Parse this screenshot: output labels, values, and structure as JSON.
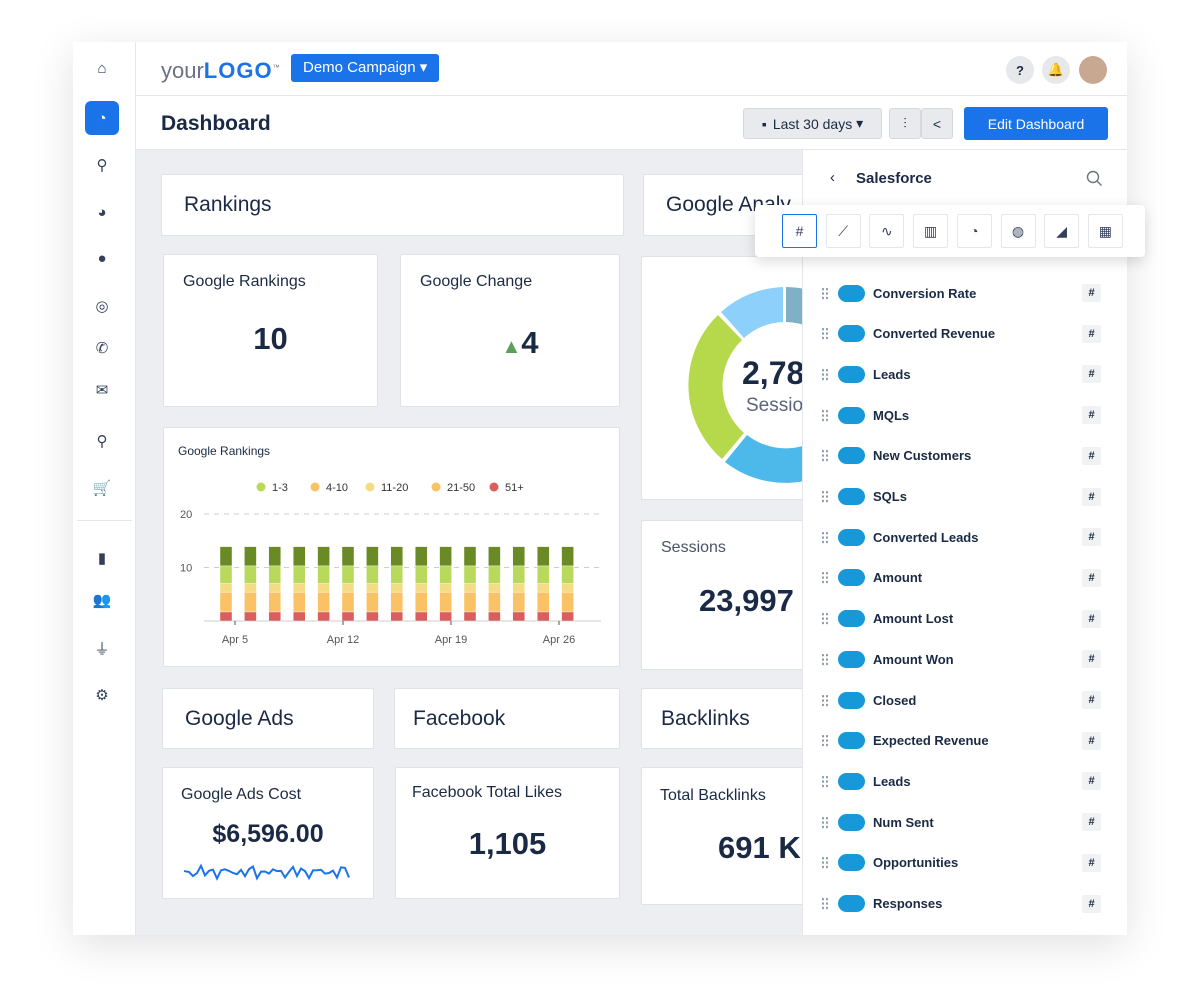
{
  "header": {
    "logo": "yourLOGO",
    "campaign": "Demo Campaign",
    "help": "?"
  },
  "toolbar": {
    "title": "Dashboard",
    "date_range": "Last 30 days",
    "edit": "Edit Dashboard"
  },
  "sidebar": {
    "icons": [
      "home-icon",
      "dashboard-icon",
      "search-icon",
      "pie-chart-icon",
      "chat-icon",
      "target-icon",
      "phone-icon",
      "mail-icon",
      "location-icon",
      "cart-icon",
      "document-icon",
      "users-icon",
      "plug-icon",
      "gear-icon"
    ]
  },
  "widgets": {
    "rankings_header": "Rankings",
    "google_rankings": {
      "label": "Google Rankings",
      "value": "10"
    },
    "google_change": {
      "label": "Google Change",
      "value": "4",
      "direction": "up"
    },
    "analytics_header": "Google Analy",
    "donut": {
      "value": "2,78",
      "label": "Sessio"
    },
    "sessions": {
      "label": "Sessions",
      "value": "23,997"
    },
    "ads_header": "Google Ads",
    "facebook_header": "Facebook",
    "backlinks_header": "Backlinks",
    "ads_cost": {
      "label": "Google Ads Cost",
      "value": "$6,596.00"
    },
    "fb_likes": {
      "label": "Facebook Total Likes",
      "value": "1,105"
    },
    "backlinks": {
      "label": "Total Backlinks",
      "value": "691 K"
    }
  },
  "chart_data": {
    "type": "bar",
    "stacked": true,
    "title": "Google Rankings",
    "ylim": [
      0,
      20
    ],
    "yticks": [
      "10",
      "20"
    ],
    "xticks": [
      "Apr 5",
      "Apr 12",
      "Apr 19",
      "Apr 26"
    ],
    "bars": 15,
    "grid": "dashed",
    "legend_position": "top",
    "series": [
      {
        "name": "51+",
        "color": "#d95f5f",
        "values": [
          1.7,
          1.7,
          1.7,
          1.7,
          1.7,
          1.7,
          1.7,
          1.7,
          1.7,
          1.7,
          1.7,
          1.7,
          1.7,
          1.7,
          1.7
        ]
      },
      {
        "name": "21-50",
        "color": "#f9c265",
        "values": [
          3.7,
          3.7,
          3.7,
          3.7,
          3.7,
          3.7,
          3.7,
          3.7,
          3.7,
          3.7,
          3.7,
          3.7,
          3.7,
          3.7,
          3.7
        ]
      },
      {
        "name": "11-20",
        "color": "#f3dc85",
        "values": [
          1.6,
          1.6,
          1.6,
          1.6,
          1.6,
          1.6,
          1.6,
          1.6,
          1.6,
          1.6,
          1.6,
          1.6,
          1.6,
          1.6,
          1.6
        ]
      },
      {
        "name": "1-3",
        "color": "#b8d95c",
        "values": [
          3.3,
          3.3,
          3.3,
          3.3,
          3.3,
          3.3,
          3.3,
          3.3,
          3.3,
          3.3,
          3.3,
          3.3,
          3.3,
          3.3,
          3.3
        ]
      },
      {
        "color": "#6a8a25",
        "values": [
          3.6,
          3.6,
          3.6,
          3.6,
          3.6,
          3.6,
          3.6,
          3.6,
          3.6,
          3.6,
          3.6,
          3.6,
          3.6,
          3.6,
          3.6
        ]
      }
    ],
    "legend": [
      {
        "name": "1-3",
        "color": "#b8d95c"
      },
      {
        "name": "4-10",
        "color": "#f9c265"
      },
      {
        "name": "11-20",
        "color": "#f3dc85"
      },
      {
        "name": "21-50",
        "color": "#f9c265"
      },
      {
        "name": "51+",
        "color": "#d95f5f"
      }
    ]
  },
  "panel": {
    "title": "Salesforce",
    "viz_types": [
      "number",
      "line-chart",
      "sparkline",
      "bar-chart",
      "pie-chart",
      "globe",
      "area-chart",
      "table"
    ],
    "source_badge": "salesforce",
    "type_badge": "#",
    "metrics": [
      "Conversion Rate",
      "Converted Revenue",
      "Leads",
      "MQLs",
      "New Customers",
      "SQLs",
      "Converted Leads",
      "Amount",
      "Amount Lost",
      "Amount Won",
      "Closed",
      "Expected Revenue",
      "Leads",
      "Num Sent",
      "Opportunities",
      "Responses"
    ]
  }
}
